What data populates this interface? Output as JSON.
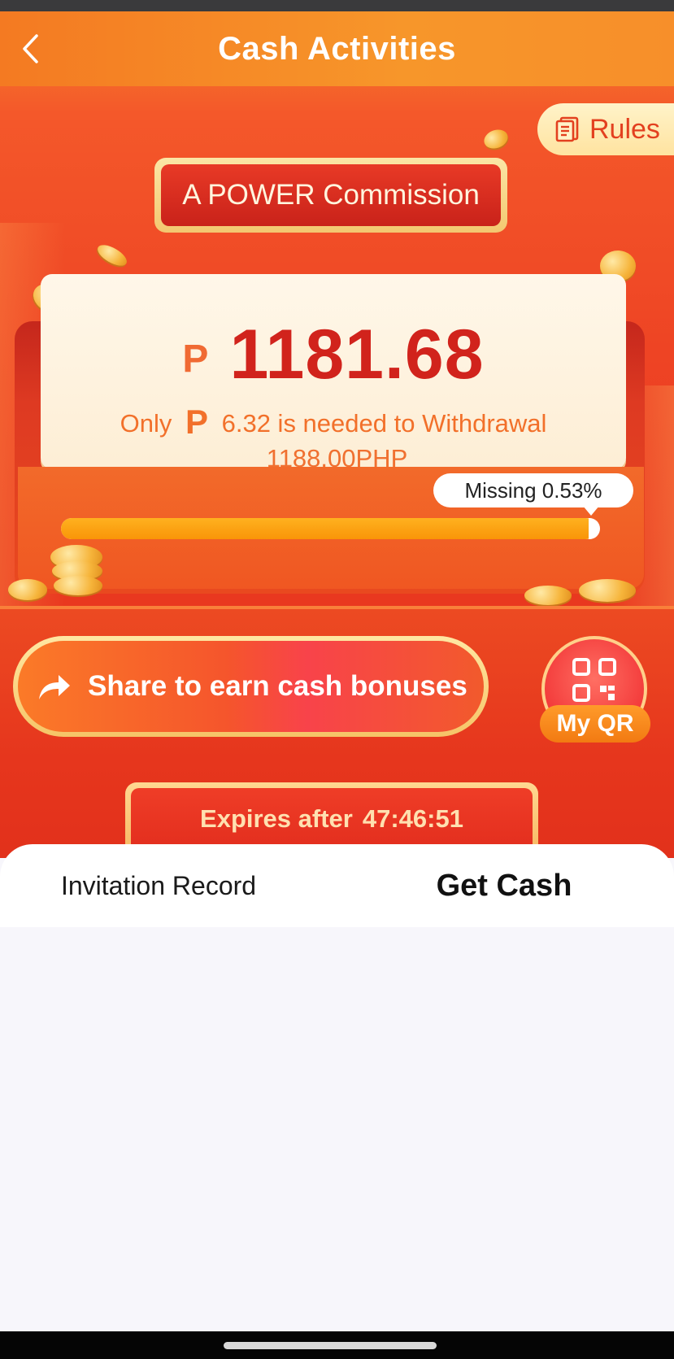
{
  "nav": {
    "title": "Cash Activities",
    "back_icon": "chevron-left-icon"
  },
  "rules": {
    "label": "Rules",
    "icon": "document-icon"
  },
  "banner": {
    "title": "A POWER Commission"
  },
  "amount": {
    "currency_symbol": "P",
    "value": "1181.68",
    "need_prefix": "Only",
    "need_amount": "6.32 is needed to Withdrawal",
    "target": "1188.00PHP"
  },
  "progress": {
    "tooltip": "Missing 0.53%",
    "percent_complete": 99.47
  },
  "actions": {
    "share_label": "Share to earn cash bonuses",
    "share_icon": "share-arrow-icon",
    "qr_label": "My QR",
    "qr_icon": "qr-code-icon"
  },
  "expires": {
    "label": "Expires after",
    "countdown": "47:46:51"
  },
  "tabs": [
    {
      "label": "Invitation Record",
      "active": false
    },
    {
      "label": "Get Cash",
      "active": true
    }
  ],
  "colors": {
    "primary": "#ee4424",
    "accent_orange": "#f99508",
    "amount_red": "#d1231c",
    "tab_active_underline": "#f0512c"
  }
}
